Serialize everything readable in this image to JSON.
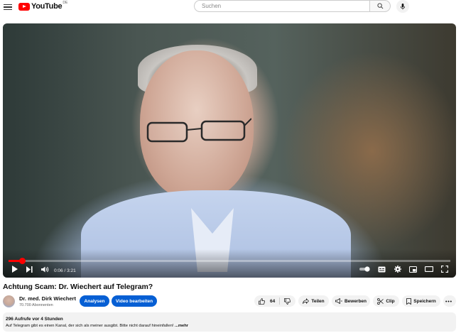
{
  "header": {
    "logo_text": "YouTube",
    "country_code": "DE",
    "search_placeholder": "Suchen"
  },
  "player": {
    "current_time": "0:06",
    "duration": "3:21",
    "time_display": "0:06 / 3:21",
    "progress_fraction": 0.03
  },
  "video": {
    "title": "Achtung Scam: Dr. Wiechert auf Telegram?",
    "channel_name": "Dr. med. Dirk Wiechert",
    "subscribers": "70.700 Abonnenten",
    "analyze_label": "Analysen",
    "edit_label": "Video bearbeiten",
    "likes": "64",
    "share_label": "Teilen",
    "promote_label": "Bewerben",
    "clip_label": "Clip",
    "save_label": "Speichern"
  },
  "description": {
    "meta": "296 Aufrufe  vor 4 Stunden",
    "text": "Auf Telegram gibt es einen Kanal, der sich als meiner ausgibt. Bitte nicht darauf hineinfallen! ",
    "more": "...mehr"
  },
  "colors": {
    "brand_red": "#ff0000",
    "accent_blue": "#065fd4"
  }
}
